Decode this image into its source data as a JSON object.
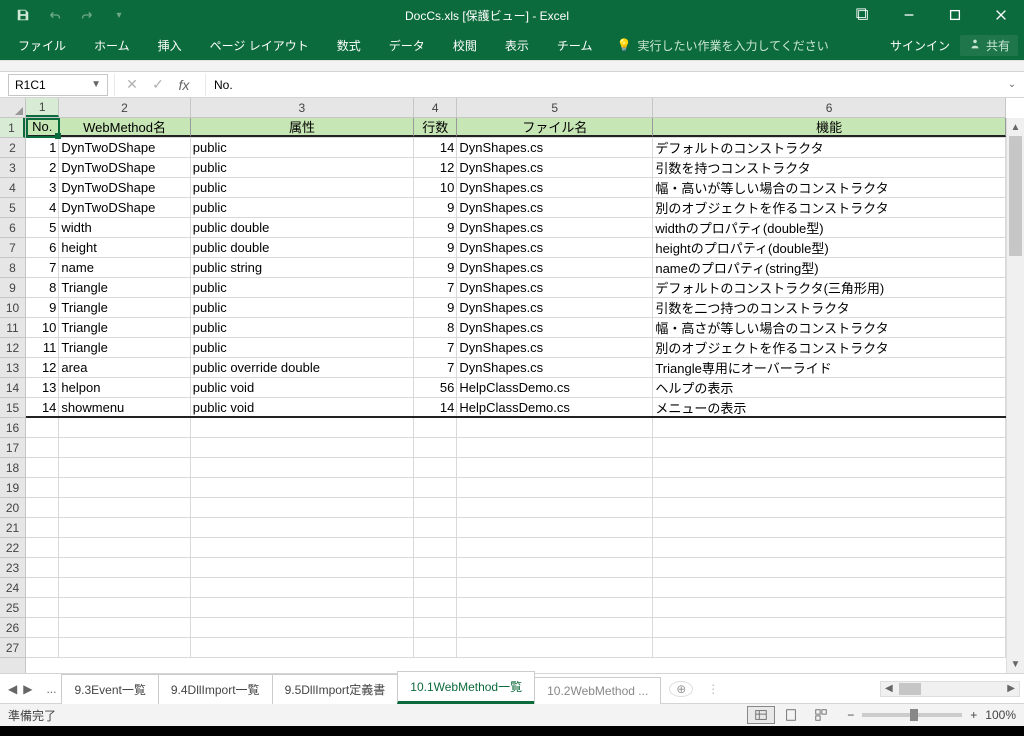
{
  "app": {
    "title": "DocCs.xls  [保護ビュー] - Excel"
  },
  "qat": {
    "save": "save",
    "undo": "undo",
    "redo": "redo"
  },
  "win": {
    "ribopts": "⬚",
    "min": "−",
    "max": "☐",
    "close": "✕"
  },
  "ribbon": {
    "tabs": [
      "ファイル",
      "ホーム",
      "挿入",
      "ページ レイアウト",
      "数式",
      "データ",
      "校閲",
      "表示",
      "チーム"
    ],
    "tell": "実行したい作業を入力してください",
    "signin": "サインイン",
    "share": "共有"
  },
  "namebox": "R1C1",
  "formula": "No.",
  "columns": [
    "1",
    "2",
    "3",
    "4",
    "5",
    "6"
  ],
  "rows_shown": 27,
  "header_row": [
    "No.",
    "WebMethod名",
    "属性",
    "行数",
    "ファイル名",
    "機能"
  ],
  "data_rows": [
    [
      "1",
      "DynTwoDShape",
      "public",
      "14",
      "DynShapes.cs",
      "デフォルトのコンストラクタ"
    ],
    [
      "2",
      "DynTwoDShape",
      "public",
      "12",
      "DynShapes.cs",
      "引数を持つコンストラクタ"
    ],
    [
      "3",
      "DynTwoDShape",
      "public",
      "10",
      "DynShapes.cs",
      "幅・高いが等しい場合のコンストラクタ"
    ],
    [
      "4",
      "DynTwoDShape",
      "public",
      "9",
      "DynShapes.cs",
      "別のオブジェクトを作るコンストラクタ"
    ],
    [
      "5",
      "width",
      "public double",
      "9",
      "DynShapes.cs",
      "widthのプロパティ(double型)"
    ],
    [
      "6",
      "height",
      "public double",
      "9",
      "DynShapes.cs",
      "heightのプロパティ(double型)"
    ],
    [
      "7",
      "name",
      "public string",
      "9",
      "DynShapes.cs",
      "nameのプロパティ(string型)"
    ],
    [
      "8",
      "Triangle",
      "public",
      "7",
      "DynShapes.cs",
      "デフォルトのコンストラクタ(三角形用)"
    ],
    [
      "9",
      "Triangle",
      "public",
      "9",
      "DynShapes.cs",
      "引数を二つ持つのコンストラクタ"
    ],
    [
      "10",
      "Triangle",
      "public",
      "8",
      "DynShapes.cs",
      "幅・高さが等しい場合のコンストラクタ"
    ],
    [
      "11",
      "Triangle",
      "public",
      "7",
      "DynShapes.cs",
      "別のオブジェクトを作るコンストラクタ"
    ],
    [
      "12",
      "area",
      "public override double",
      "7",
      "DynShapes.cs",
      "Triangle専用にオーバーライド"
    ],
    [
      "13",
      "helpon",
      "public void",
      "56",
      "HelpClassDemo.cs",
      "ヘルプの表示"
    ],
    [
      "14",
      "showmenu",
      "public void",
      "14",
      "HelpClassDemo.cs",
      "メニューの表示"
    ]
  ],
  "sheets": {
    "list": [
      "9.3Event一覧",
      "9.4DllImport一覧",
      "9.5DllImport定義書",
      "10.1WebMethod一覧",
      "10.2WebMethod ..."
    ],
    "active_index": 3
  },
  "status": {
    "ready": "準備完了",
    "zoom": "100%"
  }
}
